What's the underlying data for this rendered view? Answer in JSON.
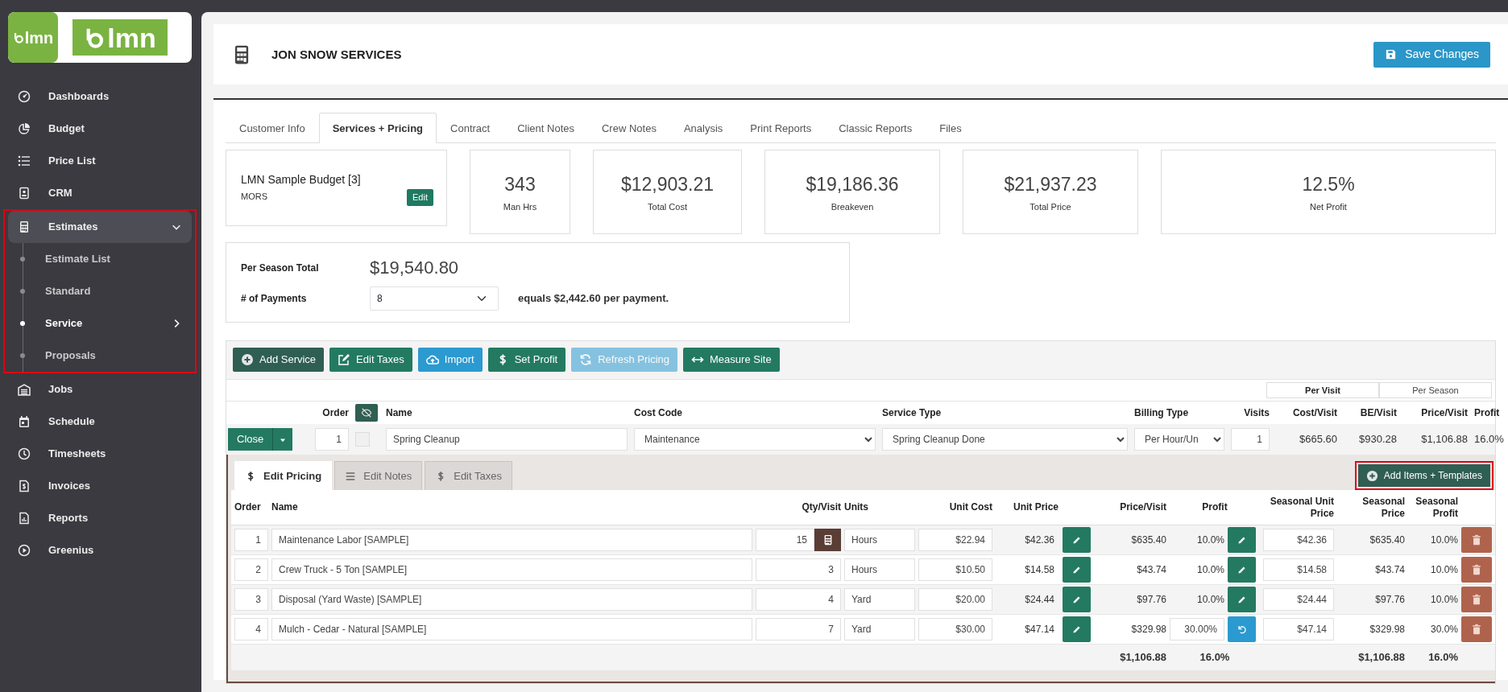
{
  "sidebar": {
    "logos": [
      {
        "text": "lmn"
      },
      {
        "text": "lmn"
      }
    ],
    "items": [
      {
        "label": "Dashboards",
        "selected": false
      },
      {
        "label": "Budget",
        "selected": false
      },
      {
        "label": "Price List",
        "selected": false
      },
      {
        "label": "CRM",
        "selected": false
      },
      {
        "label": "Estimates",
        "selected": true,
        "expanded": true,
        "highlighted": true,
        "children": [
          {
            "label": "Estimate List",
            "selected": false,
            "has_submenu": false
          },
          {
            "label": "Standard",
            "selected": false,
            "has_submenu": false
          },
          {
            "label": "Service",
            "selected": true,
            "has_submenu": true
          },
          {
            "label": "Proposals",
            "selected": false,
            "has_submenu": false
          }
        ]
      },
      {
        "label": "Jobs",
        "selected": false
      },
      {
        "label": "Schedule",
        "selected": false
      },
      {
        "label": "Timesheets",
        "selected": false
      },
      {
        "label": "Invoices",
        "selected": false
      },
      {
        "label": "Reports",
        "selected": false
      },
      {
        "label": "Greenius",
        "selected": false
      }
    ]
  },
  "header": {
    "title": "JON SNOW SERVICES",
    "save_button": "Save Changes"
  },
  "tabs": [
    {
      "label": "Customer Info",
      "selected": false
    },
    {
      "label": "Services + Pricing",
      "selected": true
    },
    {
      "label": "Contract",
      "selected": false
    },
    {
      "label": "Client Notes",
      "selected": false
    },
    {
      "label": "Crew Notes",
      "selected": false
    },
    {
      "label": "Analysis",
      "selected": false
    },
    {
      "label": "Print Reports",
      "selected": false
    },
    {
      "label": "Classic Reports",
      "selected": false
    },
    {
      "label": "Files",
      "selected": false
    }
  ],
  "budget": {
    "name": "LMN Sample Budget [3]",
    "code": "MORS",
    "edit_button": "Edit"
  },
  "stats": [
    {
      "value": "343",
      "label": "Man Hrs"
    },
    {
      "value": "$12,903.21",
      "label": "Total Cost"
    },
    {
      "value": "$19,186.36",
      "label": "Breakeven"
    },
    {
      "value": "$21,937.23",
      "label": "Total Price"
    },
    {
      "value": "12.5%",
      "label": "Net Profit"
    }
  ],
  "season": {
    "label": "Per Season Total",
    "total": "$19,540.80",
    "payments_label": "# of Payments",
    "payments": "8",
    "equals": "equals $2,442.60 per payment."
  },
  "toolbar": [
    {
      "label": "Add Service",
      "kind": "add",
      "disabled": false
    },
    {
      "label": "Edit Taxes",
      "kind": "edit",
      "disabled": false
    },
    {
      "label": "Import",
      "kind": "import",
      "disabled": false
    },
    {
      "label": "Set Profit",
      "kind": "profit",
      "disabled": false
    },
    {
      "label": "Refresh Pricing",
      "kind": "refresh",
      "disabled": true
    },
    {
      "label": "Measure Site",
      "kind": "measure",
      "disabled": false
    }
  ],
  "view_toggle": [
    {
      "label": "Per Visit",
      "selected": true
    },
    {
      "label": "Per Season",
      "selected": false
    }
  ],
  "service_columns": [
    "Order",
    "Name",
    "Cost Code",
    "Service Type",
    "Billing Type",
    "Visits",
    "Cost/Visit",
    "BE/Visit",
    "Price/Visit",
    "Profit"
  ],
  "service": {
    "close_button": "Close",
    "order": "1",
    "checked": false,
    "name": "Spring Cleanup",
    "cost_code": "Maintenance",
    "service_type": "Spring Cleanup Done",
    "billing_type": "Per Hour/Un",
    "visits": "1",
    "cost_visit": "$665.60",
    "be_visit": "$930.28",
    "price_visit": "$1,106.88",
    "profit": "16.0%"
  },
  "edit_tabs": [
    {
      "label": "Edit Pricing",
      "kind": "dollar",
      "selected": true
    },
    {
      "label": "Edit Notes",
      "kind": "lines",
      "selected": false
    },
    {
      "label": "Edit Taxes",
      "kind": "dollar",
      "selected": false
    }
  ],
  "add_items_button": {
    "label": "Add Items + Templates",
    "highlighted": true
  },
  "item_columns": [
    "Order",
    "Name",
    "Qty/Visit",
    "Units",
    "Unit Cost",
    "Unit Price",
    "Price/Visit",
    "Profit",
    "Seasonal Unit Price",
    "Seasonal Price",
    "Seasonal Profit"
  ],
  "items": [
    {
      "order": "1",
      "name": "Maintenance Labor [SAMPLE]",
      "qty": "15",
      "calculator": true,
      "units": "Hours",
      "unit_cost": "$22.94",
      "unit_price": "$42.36",
      "price_visit": "$635.40",
      "profit": "10.0%",
      "profit_override": false,
      "seasonal_unit_price": "$42.36",
      "seasonal_price": "$635.40",
      "seasonal_profit": "10.0%"
    },
    {
      "order": "2",
      "name": "Crew Truck - 5 Ton [SAMPLE]",
      "qty": "3",
      "calculator": false,
      "units": "Hours",
      "unit_cost": "$10.50",
      "unit_price": "$14.58",
      "price_visit": "$43.74",
      "profit": "10.0%",
      "profit_override": false,
      "seasonal_unit_price": "$14.58",
      "seasonal_price": "$43.74",
      "seasonal_profit": "10.0%"
    },
    {
      "order": "3",
      "name": "Disposal (Yard Waste) [SAMPLE]",
      "qty": "4",
      "calculator": false,
      "units": "Yard",
      "unit_cost": "$20.00",
      "unit_price": "$24.44",
      "price_visit": "$97.76",
      "profit": "10.0%",
      "profit_override": false,
      "seasonal_unit_price": "$24.44",
      "seasonal_price": "$97.76",
      "seasonal_profit": "10.0%"
    },
    {
      "order": "4",
      "name": "Mulch - Cedar - Natural [SAMPLE]",
      "qty": "7",
      "calculator": false,
      "units": "Yard",
      "unit_cost": "$30.00",
      "unit_price": "$47.14",
      "price_visit": "$329.98",
      "profit": "30.00%",
      "profit_override": true,
      "seasonal_unit_price": "$47.14",
      "seasonal_price": "$329.98",
      "seasonal_profit": "30.0%"
    }
  ],
  "totals": {
    "price_visit": "$1,106.88",
    "profit": "16.0%",
    "seasonal_price": "$1,106.88",
    "seasonal_profit": "16.0%"
  }
}
